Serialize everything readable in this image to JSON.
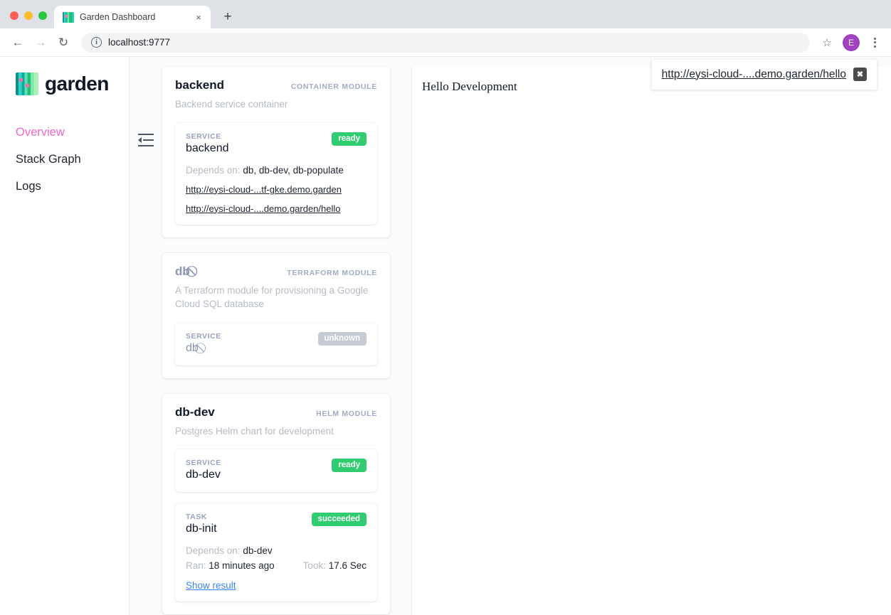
{
  "browser": {
    "tab": {
      "title": "Garden Dashboard",
      "favicon": "garden-logo-icon",
      "close": "×"
    },
    "new_tab": "+",
    "nav": {
      "back": "←",
      "forward": "→",
      "reload": "↻"
    },
    "omnibox": {
      "info_icon": "i",
      "url": "localhost:9777"
    },
    "star": "☆",
    "avatar": "E"
  },
  "sidebar": {
    "brand": "garden",
    "items": [
      {
        "label": "Overview",
        "active": true
      },
      {
        "label": "Stack Graph",
        "active": false
      },
      {
        "label": "Logs",
        "active": false
      }
    ],
    "collapse_label": "Collapse sidebar"
  },
  "modules": [
    {
      "name": "backend",
      "type": "CONTAINER MODULE",
      "description": "Backend service container",
      "disabled": false,
      "entities": [
        {
          "kind": "SERVICE",
          "name": "backend",
          "status": "ready",
          "status_class": "ready",
          "depends_label": "Depends on:",
          "depends_value": "db, db-dev, db-populate",
          "ingresses": [
            "http://eysi-cloud-...tf-gke.demo.garden",
            "http://eysi-cloud-....demo.garden/hello"
          ]
        }
      ]
    },
    {
      "name": "db",
      "name_suffix_icon": "⃠",
      "type": "TERRAFORM MODULE",
      "description": "A Terraform module for provisioning a Google Cloud SQL database",
      "disabled": true,
      "entities": [
        {
          "kind": "SERVICE",
          "name": "db",
          "name_suffix_icon": "⃠",
          "status": "unknown",
          "status_class": "unknown",
          "disabled": true
        }
      ]
    },
    {
      "name": "db-dev",
      "type": "HELM MODULE",
      "description": "Postgres Helm chart for development",
      "disabled": false,
      "entities": [
        {
          "kind": "SERVICE",
          "name": "db-dev",
          "status": "ready",
          "status_class": "ready"
        },
        {
          "kind": "TASK",
          "name": "db-init",
          "status": "succeeded",
          "status_class": "succeeded",
          "depends_label": "Depends on:",
          "depends_value": "db-dev",
          "ran_label": "Ran:",
          "ran_value": "18 minutes ago",
          "took_label": "Took:",
          "took_value": "17.6 Sec",
          "show_result": "Show result"
        }
      ]
    }
  ],
  "preview": {
    "page_title": "Hello Development",
    "url": "http://eysi-cloud-....demo.garden/hello",
    "close_glyph": "✖"
  },
  "colors": {
    "accent_pink": "#ef6ac8",
    "status_green": "#2fcc70",
    "status_grey": "#c6cbd4",
    "link_blue": "#3c82f6",
    "module_type_grey": "#a2abc4"
  }
}
